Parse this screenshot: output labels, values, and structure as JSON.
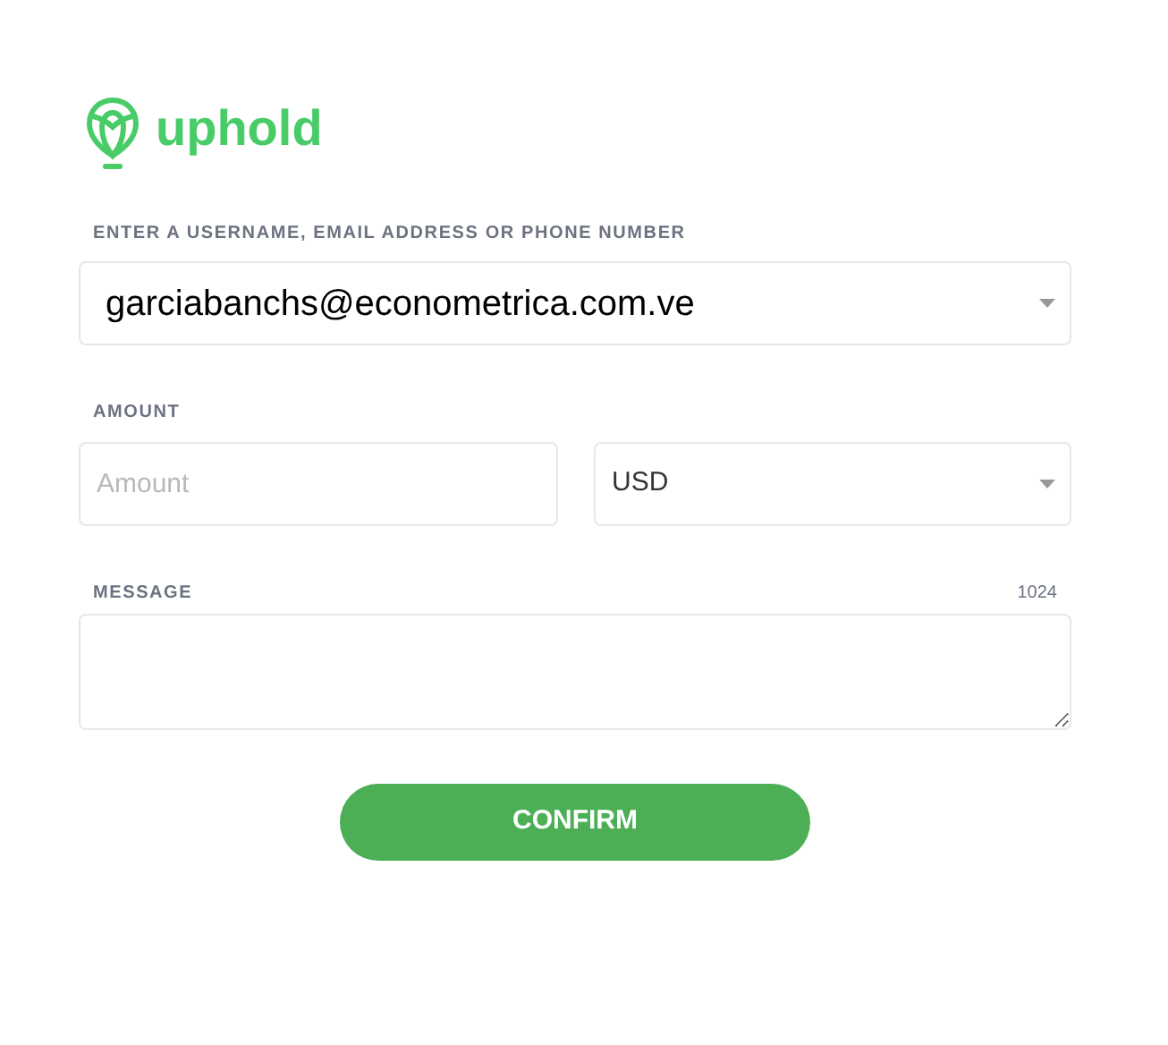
{
  "brand": {
    "name": "uphold"
  },
  "recipient": {
    "label": "ENTER A USERNAME, EMAIL ADDRESS OR PHONE NUMBER",
    "value": "garciabanchs@econometrica.com.ve"
  },
  "amount": {
    "label": "AMOUNT",
    "placeholder": "Amount",
    "currency": "USD"
  },
  "message": {
    "label": "MESSAGE",
    "counter": "1024"
  },
  "confirm_button": "CONFIRM"
}
